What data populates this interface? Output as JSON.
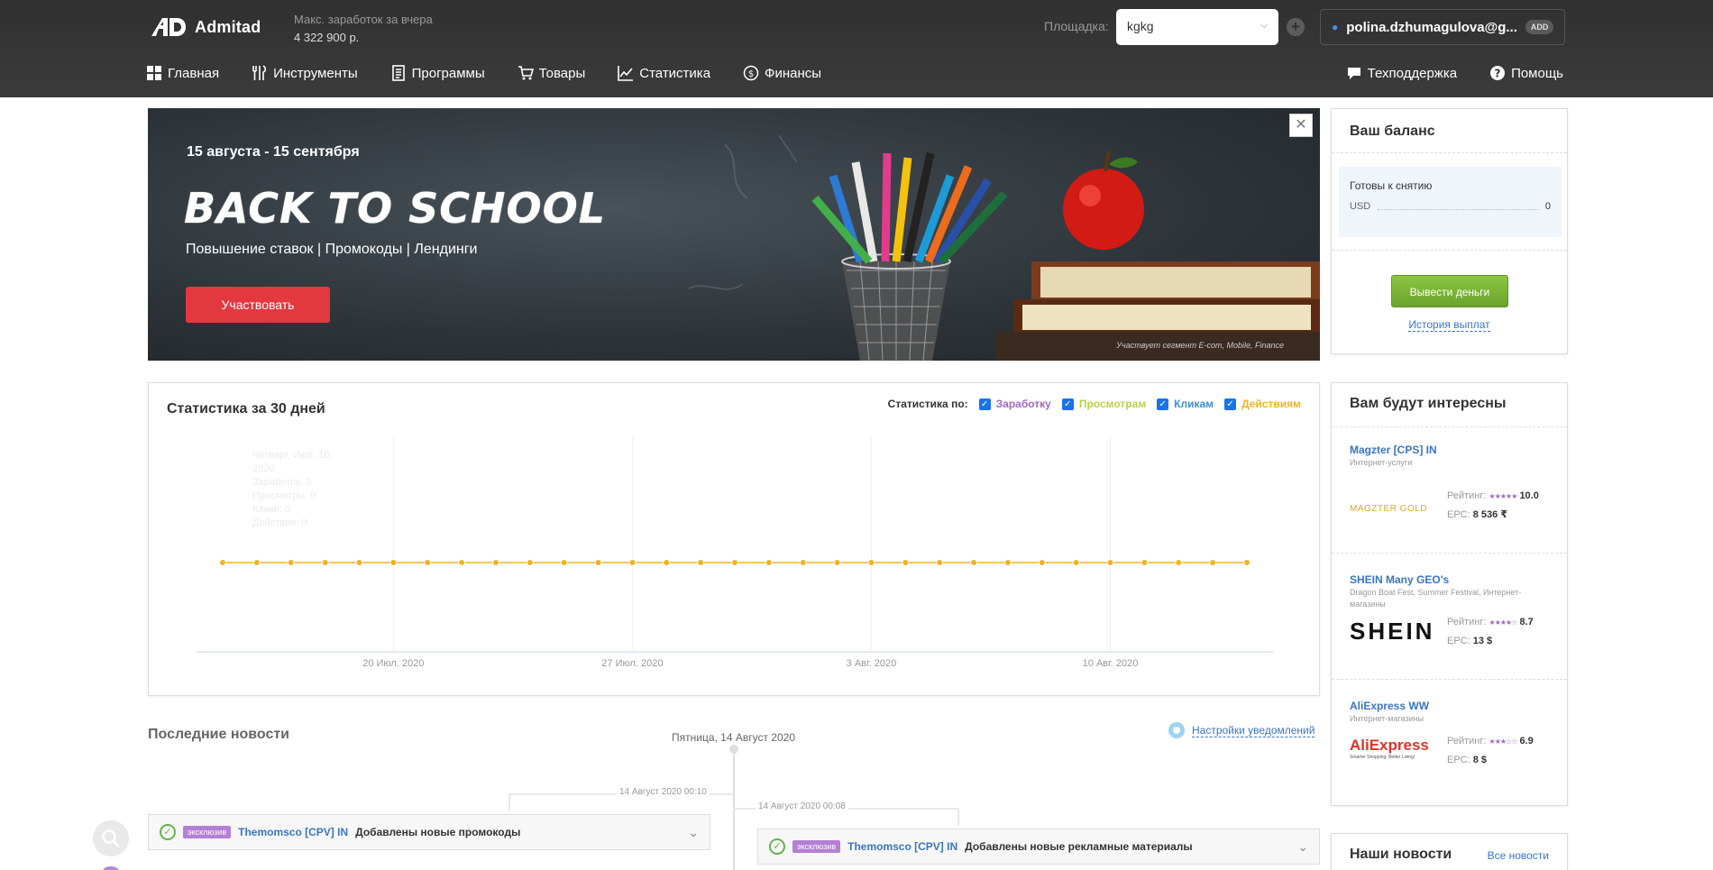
{
  "header": {
    "logo_text": "Admitad",
    "earn_label": "Макс. заработок за вчера",
    "earn_value": "4 322 900 р.",
    "platform_label": "Площадка:",
    "platform_value": "kgkg",
    "user_email": "polina.dzhumagulova@g...",
    "user_badge": "ADD"
  },
  "nav": {
    "items": [
      {
        "label": "Главная",
        "icon": "grid-icon"
      },
      {
        "label": "Инструменты",
        "icon": "tools-icon"
      },
      {
        "label": "Программы",
        "icon": "document-icon"
      },
      {
        "label": "Товары",
        "icon": "cart-icon"
      },
      {
        "label": "Статистика",
        "icon": "chart-icon"
      },
      {
        "label": "Финансы",
        "icon": "dollar-icon"
      }
    ],
    "support_label": "Техподдержка",
    "help_label": "Помощь"
  },
  "banner": {
    "dates": "15 августа - 15 сентября",
    "title": "BACK TO SCHOOL",
    "subtitle": "Повышение ставок  |  Промокоды |  Лендинги",
    "button": "Участвовать",
    "note": "Участвует сегмент E-com, Mobile, Finance"
  },
  "balance": {
    "title": "Ваш баланс",
    "ready_label": "Готовы к снятию",
    "currency": "USD",
    "amount": "0",
    "withdraw_button": "Вывести деньги",
    "history_link": "История выплат"
  },
  "stats": {
    "title": "Статистика за 30 дней",
    "filter_label": "Статистика по:",
    "filters": [
      {
        "label": "Заработку",
        "color": "#a566c6"
      },
      {
        "label": "Просмотрам",
        "color": "#b8d24a"
      },
      {
        "label": "Кликам",
        "color": "#3d8fd6"
      },
      {
        "label": "Действиям",
        "color": "#f0b323"
      }
    ],
    "tooltip": {
      "date": "Четверг, Июл. 16, 2020",
      "rows": [
        {
          "label": "Заработок:",
          "value": "0"
        },
        {
          "label": "Просмотры:",
          "value": "0"
        },
        {
          "label": "Клики:",
          "value": "0"
        },
        {
          "label": "Действия:",
          "value": "0"
        }
      ]
    }
  },
  "chart_data": {
    "type": "line",
    "x": [
      "15 Июл.",
      "16 Июл.",
      "17 Июл.",
      "18 Июл.",
      "19 Июл.",
      "20 Июл.",
      "21 Июл.",
      "22 Июл.",
      "23 Июл.",
      "24 Июл.",
      "25 Июл.",
      "26 Июл.",
      "27 Июл.",
      "28 Июл.",
      "29 Июл.",
      "30 Июл.",
      "31 Июл.",
      "1 Авг.",
      "2 Авг.",
      "3 Авг.",
      "4 Авг.",
      "5 Авг.",
      "6 Авг.",
      "7 Авг.",
      "8 Авг.",
      "9 Авг.",
      "10 Авг.",
      "11 Авг.",
      "12 Авг.",
      "13 Авг.",
      "14 Авг."
    ],
    "x_ticks": [
      "20 Июл. 2020",
      "27 Июл. 2020",
      "3 Авг. 2020",
      "10 Авг. 2020"
    ],
    "series": [
      {
        "name": "Действиям",
        "color": "#f0b323",
        "values": [
          0,
          0,
          0,
          0,
          0,
          0,
          0,
          0,
          0,
          0,
          0,
          0,
          0,
          0,
          0,
          0,
          0,
          0,
          0,
          0,
          0,
          0,
          0,
          0,
          0,
          0,
          0,
          0,
          0,
          0,
          0
        ]
      }
    ],
    "grid": true
  },
  "news": {
    "title": "Последние новости",
    "date_header": "Пятница, 14 Август 2020",
    "notif_link": "Настройки уведомлений",
    "time_left": "14 Август 2020 00:10",
    "time_right": "14 Август 2020 00:08",
    "cards": [
      {
        "tag": "эксклюзив",
        "program": "Themomsco [CPV] IN",
        "text": "Добавлены новые промокоды"
      },
      {
        "tag": "эксклюзив",
        "program": "Themomsco [CPV] IN",
        "text": "Добавлены новые рекламные материалы"
      }
    ]
  },
  "recs": {
    "title": "Вам будут интересны",
    "rating_label": "Рейтинг:",
    "epc_label": "EPC:",
    "items": [
      {
        "name": "Magzter [CPS] IN",
        "category": "Интернет-услуги",
        "logo": "MAGZTER GOLD",
        "rating": "10.0",
        "epc": "8 536 ₹"
      },
      {
        "name": "SHEIN Many GEO's",
        "category": "Dragon Boat Fest, Summer Festival, Интернет-магазины",
        "logo": "SHEIN",
        "rating": "8.7",
        "epc": "13 $"
      },
      {
        "name": "AliExpress WW",
        "category": "Интернет-магазины",
        "logo": "AliExpress",
        "logo_tag": "Smarter Shopping, Better Living!",
        "rating": "6.9",
        "epc": "8 $"
      }
    ]
  },
  "our_news": {
    "title": "Наши новости",
    "all_link": "Все новости"
  }
}
